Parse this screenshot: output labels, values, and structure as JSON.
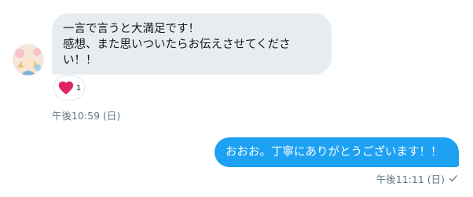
{
  "incoming": {
    "message": "一言で言うと大満足です！\n感想、また思いついたらお伝えさせてください！！",
    "reaction_count": "1",
    "timestamp": "午後10:59 (日)"
  },
  "outgoing": {
    "message": "おおお。丁寧にありがとうございます！！",
    "timestamp": "午後11:11 (日)"
  },
  "icons": {
    "reaction": "heart-icon",
    "read_status": "checkmark-icon"
  },
  "colors": {
    "incoming_bubble": "#e6ecf0",
    "outgoing_bubble": "#1da1f2",
    "heart": "#e0245e",
    "timestamp": "#657786"
  }
}
